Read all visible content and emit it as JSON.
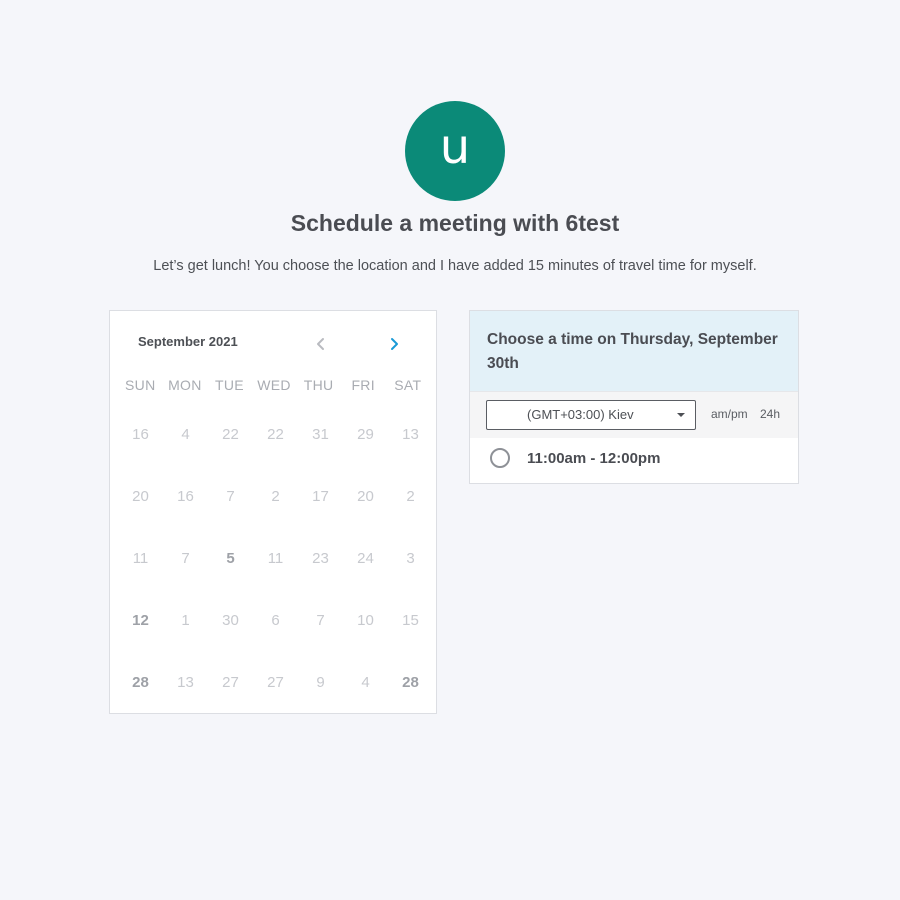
{
  "host": {
    "avatar_letter": "u",
    "avatar_color": "#0b8a78"
  },
  "header": {
    "title": "Schedule a meeting with 6test",
    "description": "Let’s get lunch! You choose the location and I have added 15 minutes of travel time for myself."
  },
  "calendar": {
    "month_label": "September 2021",
    "prev_icon": "chevron-left-icon",
    "next_icon": "chevron-right-icon",
    "next_icon_color": "#1a9ad6",
    "weekdays": [
      "SUN",
      "MON",
      "TUE",
      "WED",
      "THU",
      "FRI",
      "SAT"
    ],
    "weeks": [
      [
        "16",
        "4",
        "22",
        "22",
        "31",
        "29",
        "13"
      ],
      [
        "20",
        "16",
        "7",
        "2",
        "17",
        "20",
        "2"
      ],
      [
        "11",
        "7",
        "5",
        "11",
        "23",
        "24",
        "3"
      ],
      [
        "12",
        "1",
        "30",
        "6",
        "7",
        "10",
        "15"
      ],
      [
        "28",
        "13",
        "27",
        "27",
        "9",
        "4",
        "28"
      ]
    ],
    "bold_days": [
      [
        2,
        2
      ],
      [
        3,
        0
      ],
      [
        4,
        0
      ],
      [
        4,
        6
      ]
    ]
  },
  "time_panel": {
    "heading": "Choose a time on Thursday, September 30th",
    "timezone": "(GMT+03:00) Kiev",
    "format_ampm": "am/pm",
    "format_24h": "24h",
    "slots": [
      {
        "label": "11:00am - 12:00pm",
        "selected": false
      }
    ]
  }
}
